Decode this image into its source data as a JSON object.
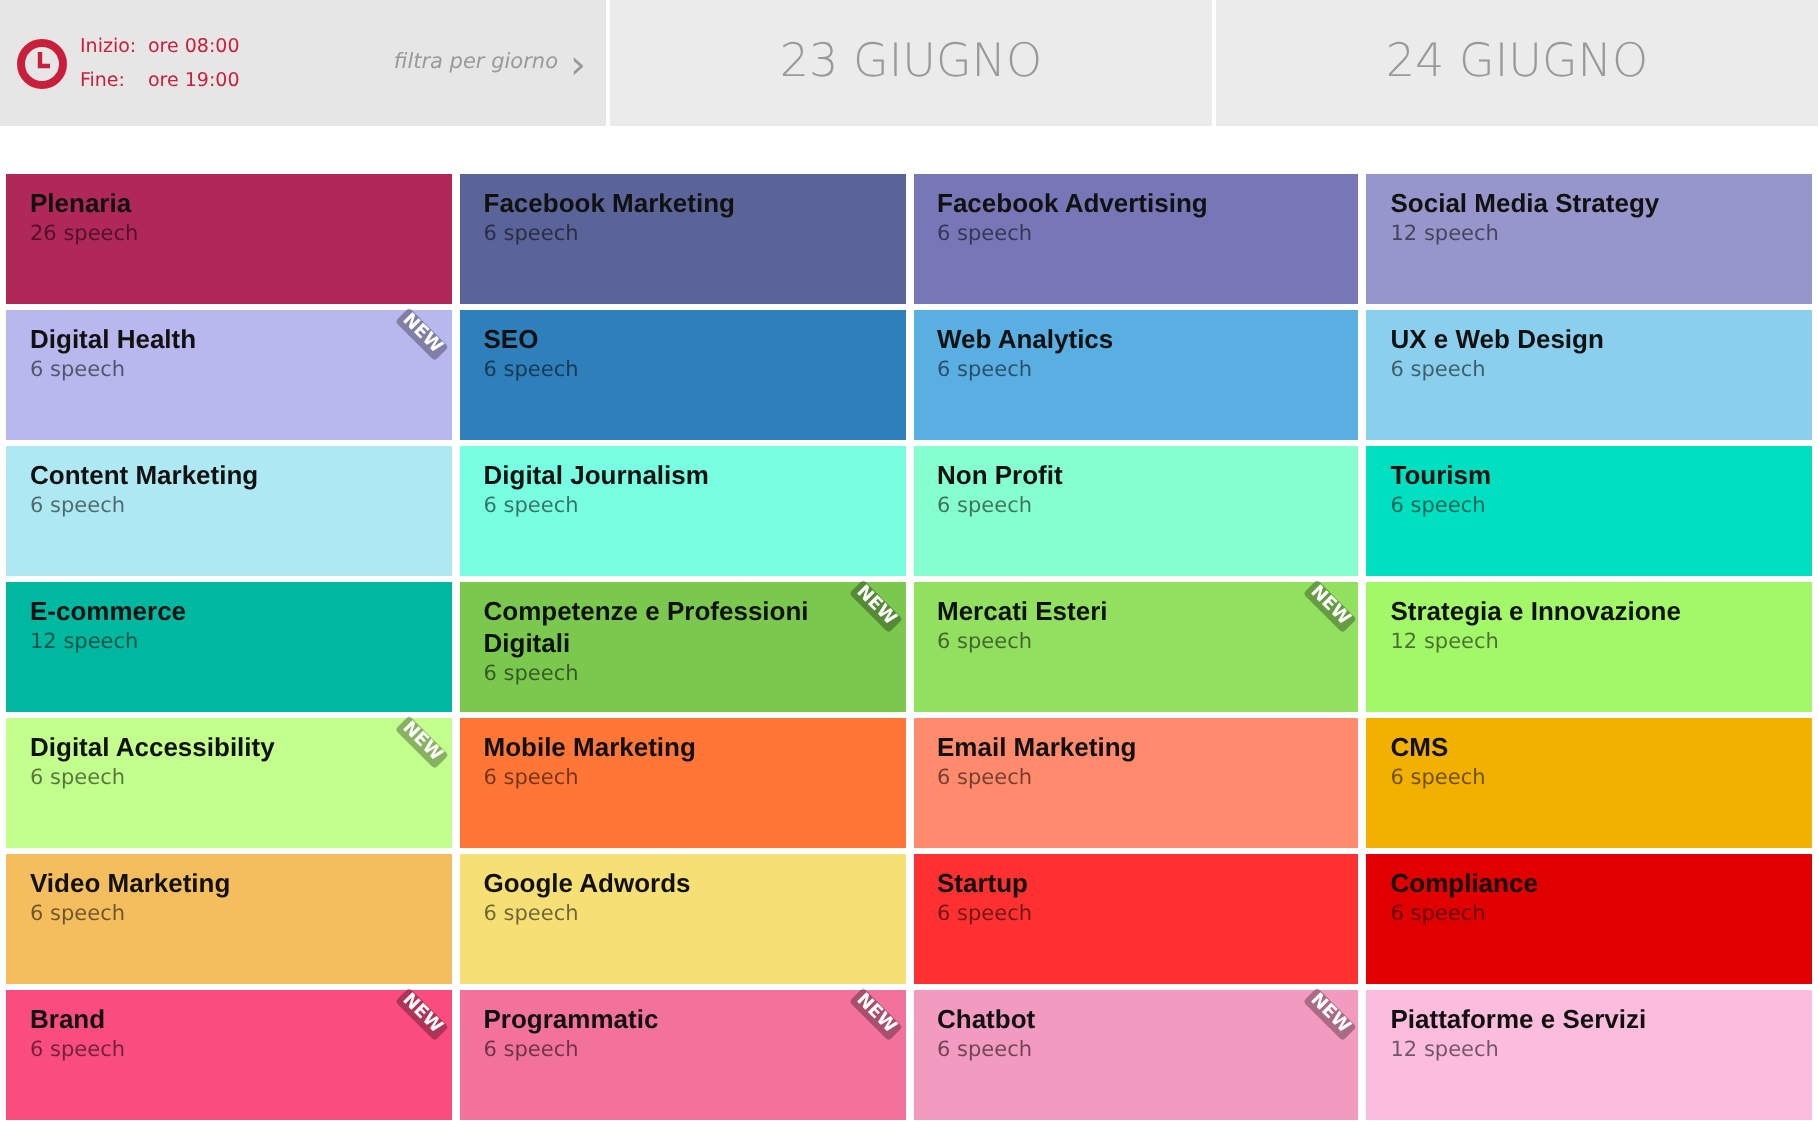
{
  "schedule": {
    "start_label": "Inizio:",
    "start_time": "ore 08:00",
    "end_label": "Fine:",
    "end_time": "ore 19:00"
  },
  "filter": {
    "label": "filtra per giorno",
    "arrow": "›"
  },
  "days": [
    "23 GIUGNO",
    "24 GIUGNO"
  ],
  "tracks": [
    {
      "title": "Plenaria",
      "count": "26 speech",
      "color": "#b02858"
    },
    {
      "title": "Facebook Marketing",
      "count": "6 speech",
      "color": "#5a6498"
    },
    {
      "title": "Facebook Advertising",
      "count": "6 speech",
      "color": "#7777b8"
    },
    {
      "title": "Social Media Strategy",
      "count": "12 speech",
      "color": "#9696cc"
    },
    {
      "title": "Digital Health",
      "count": "6 speech",
      "color": "#b8b8ee",
      "badge": "NEW"
    },
    {
      "title": "SEO",
      "count": "6 speech",
      "color": "#2f7fbb"
    },
    {
      "title": "Web Analytics",
      "count": "6 speech",
      "color": "#5aafe2"
    },
    {
      "title": "UX e Web Design",
      "count": "6 speech",
      "color": "#8acfee"
    },
    {
      "title": "Content Marketing",
      "count": "6 speech",
      "color": "#aee8f2"
    },
    {
      "title": "Digital Journalism",
      "count": "6 speech",
      "color": "#78ffe2"
    },
    {
      "title": "Non Profit",
      "count": "6 speech",
      "color": "#86ffd0"
    },
    {
      "title": "Tourism",
      "count": "6 speech",
      "color": "#00e0c0"
    },
    {
      "title": "E-commerce",
      "count": "12 speech",
      "color": "#00b8a0"
    },
    {
      "title": "Competenze e Professioni Digitali",
      "count": "6 speech",
      "color": "#7ac84e",
      "badge": "NEW"
    },
    {
      "title": "Mercati Esteri",
      "count": "6 speech",
      "color": "#92e060",
      "badge": "NEW"
    },
    {
      "title": "Strategia e Innovazione",
      "count": "12 speech",
      "color": "#a2f868"
    },
    {
      "title": "Digital Accessibility",
      "count": "6 speech",
      "color": "#c2ff8c",
      "badge": "NEW"
    },
    {
      "title": "Mobile Marketing",
      "count": "6 speech",
      "color": "#ff7636"
    },
    {
      "title": "Email Marketing",
      "count": "6 speech",
      "color": "#ff8a6c"
    },
    {
      "title": "CMS",
      "count": "6 speech",
      "color": "#f2b000"
    },
    {
      "title": "Video Marketing",
      "count": "6 speech",
      "color": "#f4be5e"
    },
    {
      "title": "Google Adwords",
      "count": "6 speech",
      "color": "#f6e076"
    },
    {
      "title": "Startup",
      "count": "6 speech",
      "color": "#ff3030"
    },
    {
      "title": "Compliance",
      "count": "6 speech",
      "color": "#e00000"
    },
    {
      "title": "Brand",
      "count": "6 speech",
      "color": "#fa4c7e",
      "badge": "NEW"
    },
    {
      "title": "Programmatic",
      "count": "6 speech",
      "color": "#f2729c",
      "badge": "NEW"
    },
    {
      "title": "Chatbot",
      "count": "6 speech",
      "color": "#f29ac0",
      "badge": "NEW"
    },
    {
      "title": "Piattaforme e Servizi",
      "count": "12 speech",
      "color": "#fcbcde"
    }
  ]
}
